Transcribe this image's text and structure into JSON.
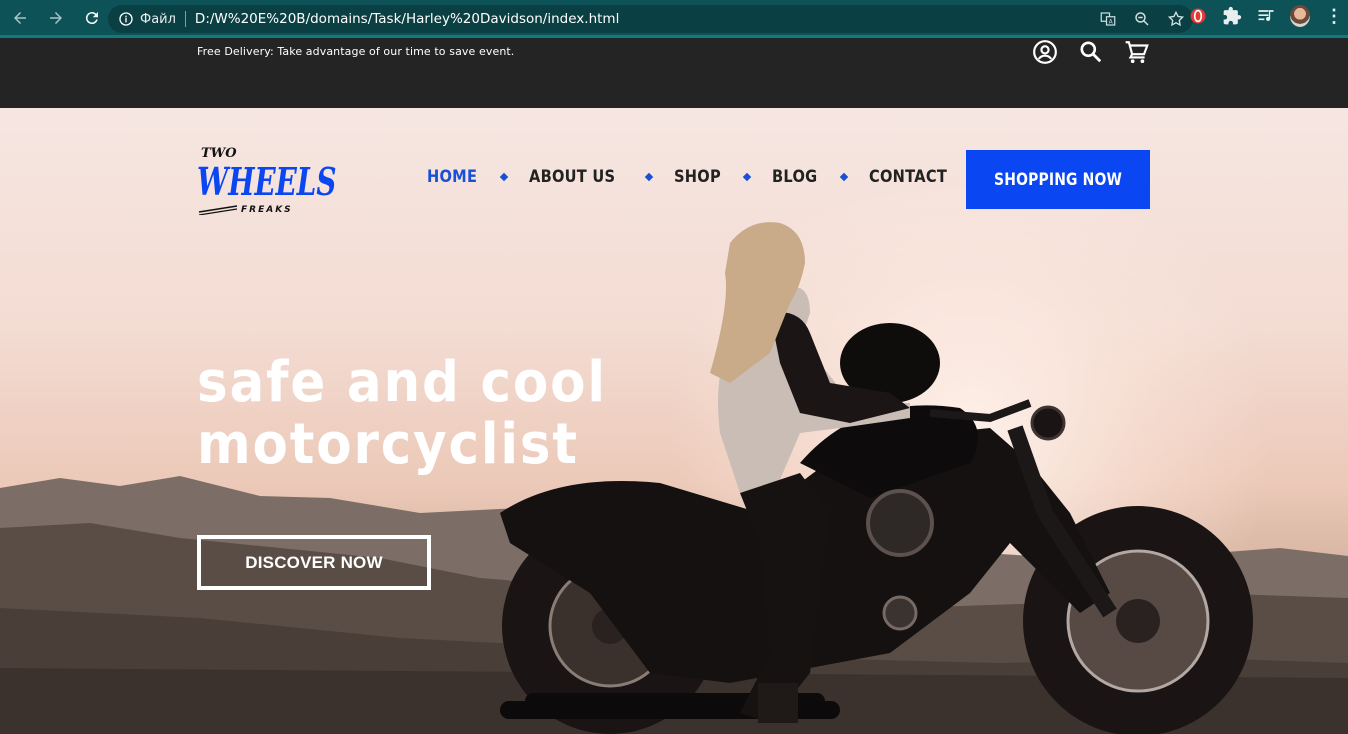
{
  "browser": {
    "file_label": "Файл",
    "url": "D:/W%20E%20B/domains/Task/Harley%20Davidson/index.html"
  },
  "topbar": {
    "delivery_text": "Free Delivery: Take advantage of our time to save event."
  },
  "brand": {
    "logo_top": "TWO",
    "logo_main": "WHEELS",
    "logo_sub": "FREAKS",
    "accent_color": "#0a46f2"
  },
  "nav": {
    "items": [
      {
        "label": "HOME",
        "active": true
      },
      {
        "label": "ABOUT US",
        "active": false
      },
      {
        "label": "SHOP",
        "active": false
      },
      {
        "label": "BLOG",
        "active": false
      },
      {
        "label": "CONTACT",
        "active": false
      }
    ],
    "cta_label": "SHOPPING NOW"
  },
  "hero": {
    "headline_line1": "safe and cool",
    "headline_line2": "motorcyclist",
    "button_label": "DISCOVER NOW"
  }
}
